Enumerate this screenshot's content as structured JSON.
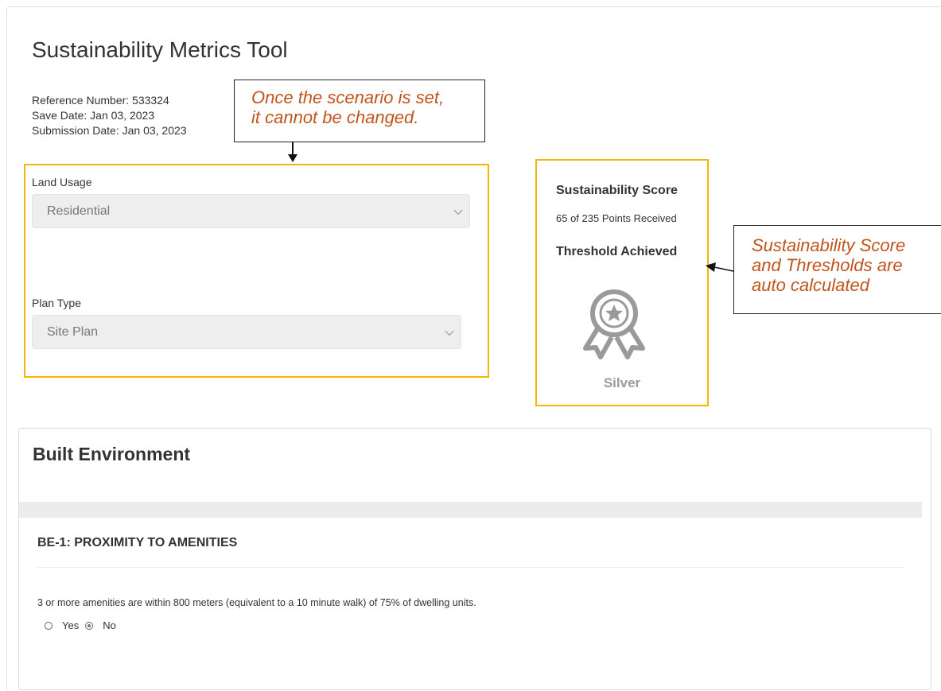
{
  "app": {
    "title": "Sustainability Metrics Tool"
  },
  "meta": {
    "reference": "Reference Number: 533324",
    "save_date": "Save Date: Jan 03, 2023",
    "submission_date": "Submission Date: Jan 03, 2023"
  },
  "callouts": {
    "scenario": [
      "Once the scenario is set,",
      "it cannot be changed."
    ],
    "score": [
      "Sustainability Score",
      "and Thresholds are",
      "auto calculated"
    ]
  },
  "fields": {
    "land_usage": {
      "label": "Land Usage",
      "value": "Residential"
    },
    "plan_type": {
      "label": "Plan Type",
      "value": "Site Plan"
    }
  },
  "score": {
    "title": "Sustainability Score",
    "points": "65 of 235 Points Received",
    "threshold_title": "Threshold Achieved",
    "level": "Silver",
    "icon": "award-ribbon-icon"
  },
  "section": {
    "title": "Built Environment",
    "item": {
      "title": "BE-1: PROXIMITY TO AMENITIES",
      "question": "3 or more amenities are within 800 meters (equivalent to a 10 minute walk) of 75% of dwelling units.",
      "options": [
        {
          "label": "Yes",
          "selected": false
        },
        {
          "label": "No",
          "selected": true
        }
      ]
    }
  },
  "colors": {
    "highlight": "#f2b705",
    "callout_text": "#c0541c",
    "medal": "#9a9a9a"
  }
}
